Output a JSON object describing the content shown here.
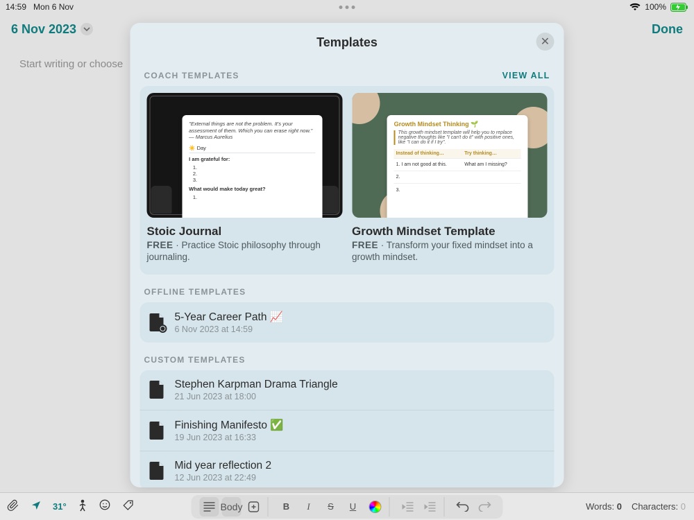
{
  "statusbar": {
    "time": "14:59",
    "date": "Mon 6 Nov",
    "battery": "100%"
  },
  "header": {
    "date_title": "6 Nov 2023",
    "done_label": "Done"
  },
  "editor": {
    "placeholder": "Start writing or choose"
  },
  "modal": {
    "title": "Templates",
    "coach_label": "COACH TEMPLATES",
    "view_all": "VIEW ALL",
    "offline_label": "OFFLINE TEMPLATES",
    "custom_label": "CUSTOM TEMPLATES"
  },
  "coach_cards": [
    {
      "title": "Stoic Journal",
      "free": "FREE",
      "desc": " · Practice Stoic philosophy through journaling.",
      "preview": {
        "quote": "\"External things are not the problem. It's your assessment of them. Which you can erase right now.\"",
        "author": "— Marcus Aurelius",
        "day_label": "☀️ Day",
        "grateful": "I am grateful for:",
        "great": "What would make today great?"
      }
    },
    {
      "title": "Growth Mindset Template",
      "free": "FREE",
      "desc": " · Transform your fixed mindset into a growth mindset.",
      "preview": {
        "heading": "Growth Mindset Thinking 🌱",
        "sub": "This growth mindset template will help you to replace negative thoughts like \"I can't do it\" with positive ones, like \"I can do it if I try\".",
        "col1": "Instead of thinking…",
        "col2": "Try thinking…",
        "row1a": "1. I am not good at this.",
        "row1b": "What am I missing?",
        "row2a": "2.",
        "row3a": "3."
      }
    }
  ],
  "offline": [
    {
      "title": "5-Year Career Path 📈",
      "subtitle": "6 Nov 2023 at 14:59"
    }
  ],
  "custom": [
    {
      "title": "Stephen Karpman Drama Triangle",
      "subtitle": "21 Jun 2023 at 18:00"
    },
    {
      "title": "Finishing Manifesto ✅",
      "subtitle": "19 Jun 2023 at 16:33"
    },
    {
      "title": "Mid year reflection 2",
      "subtitle": "12 Jun 2023 at 22:49"
    }
  ],
  "toolbar": {
    "temperature": "31°",
    "body_label": "Body",
    "words_label": "Words:",
    "words_value": "0",
    "chars_label": "Characters:",
    "chars_value": "0"
  }
}
